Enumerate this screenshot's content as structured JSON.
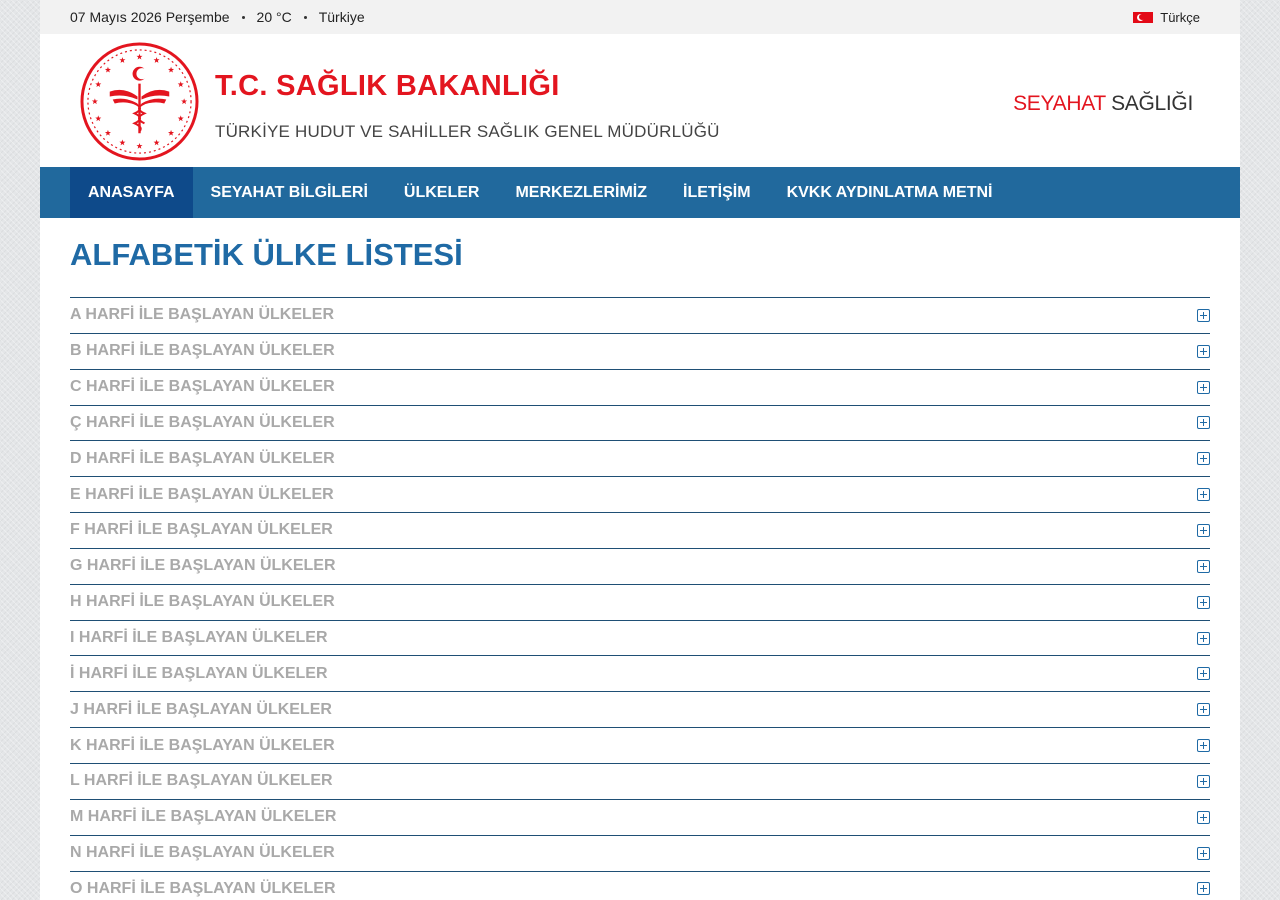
{
  "topbar": {
    "date": "07 Mayıs 2026 Perşembe",
    "temperature": "20 °C",
    "location": "Türkiye",
    "language": "Türkçe"
  },
  "header": {
    "title": "T.C. SAĞLIK BAKANLIĞI",
    "subtitle": "TÜRKİYE HUDUT VE SAHİLLER SAĞLIK GENEL MÜDÜRLÜĞÜ",
    "brand_part1": "SEYAHAT",
    "brand_part2": "SAĞLIĞI"
  },
  "nav": {
    "items": [
      {
        "label": "ANASAYFA",
        "active": true
      },
      {
        "label": "SEYAHAT BİLGİLERİ"
      },
      {
        "label": "ÜLKELER"
      },
      {
        "label": "MERKEZLERİMİZ"
      },
      {
        "label": "İLETİŞİM"
      },
      {
        "label": "KVKK AYDINLATMA METNİ"
      }
    ]
  },
  "page": {
    "title": "ALFABETİK ÜLKE LİSTESİ"
  },
  "accordion": {
    "items": [
      "A HARFİ İLE BAŞLAYAN ÜLKELER",
      "B HARFİ İLE BAŞLAYAN ÜLKELER",
      "C HARFİ İLE BAŞLAYAN ÜLKELER",
      "Ç HARFİ İLE BAŞLAYAN ÜLKELER",
      "D HARFİ İLE BAŞLAYAN ÜLKELER",
      "E HARFİ İLE BAŞLAYAN ÜLKELER",
      "F HARFİ İLE BAŞLAYAN ÜLKELER",
      "G HARFİ İLE BAŞLAYAN ÜLKELER",
      "H HARFİ İLE BAŞLAYAN ÜLKELER",
      "I HARFİ İLE BAŞLAYAN ÜLKELER",
      "İ HARFİ İLE BAŞLAYAN ÜLKELER",
      "J HARFİ İLE BAŞLAYAN ÜLKELER",
      "K HARFİ İLE BAŞLAYAN ÜLKELER",
      "L HARFİ İLE BAŞLAYAN ÜLKELER",
      "M HARFİ İLE BAŞLAYAN ÜLKELER",
      "N HARFİ İLE BAŞLAYAN ÜLKELER",
      "O HARFİ İLE BAŞLAYAN ÜLKELER"
    ]
  },
  "colors": {
    "nav_bg": "#21699d",
    "nav_active": "#0e4a8a",
    "brand_red": "#e3151f",
    "title_blue": "#1f6aa5"
  }
}
